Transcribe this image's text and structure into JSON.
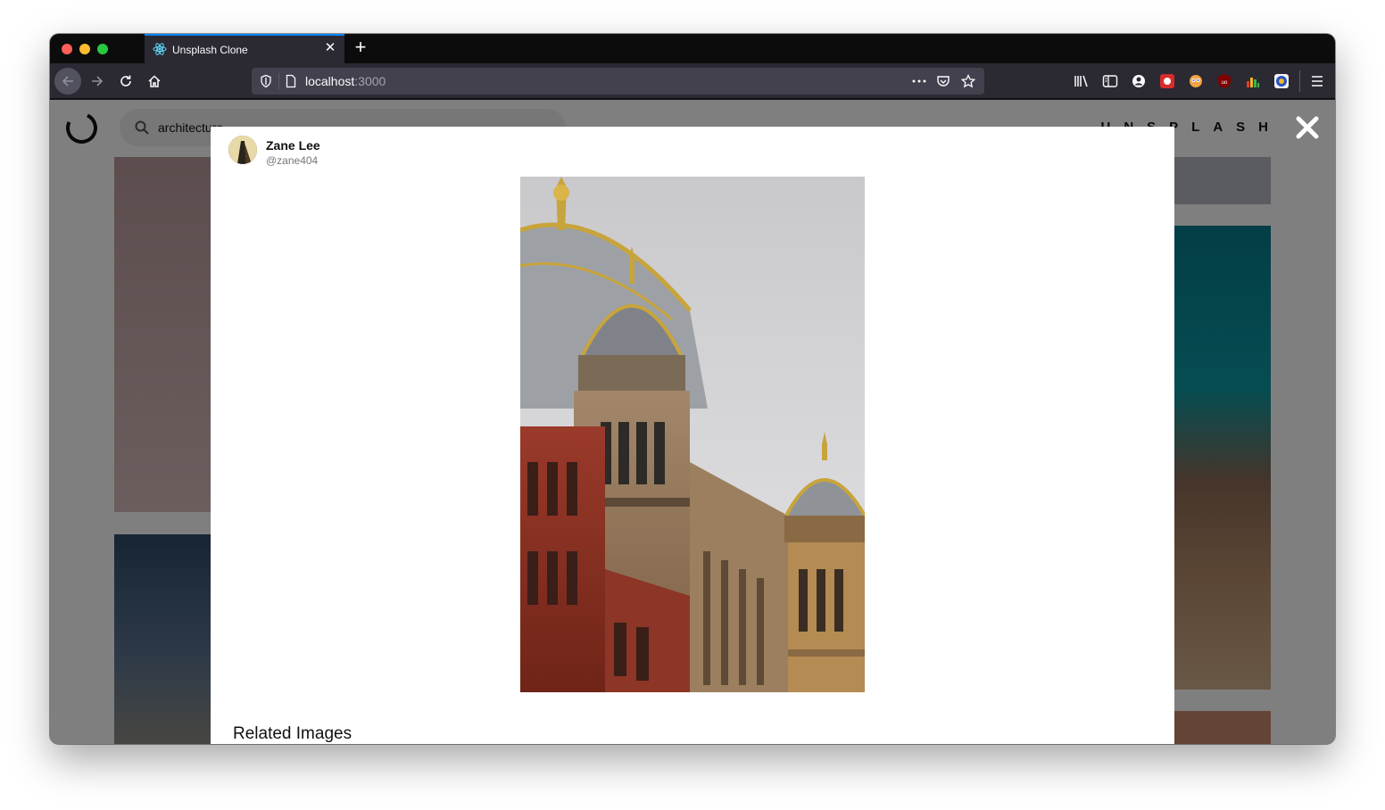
{
  "browser": {
    "tab_title": "Unsplash Clone",
    "url_host": "localhost",
    "url_port": ":3000"
  },
  "app": {
    "search_query": "architecture",
    "brand": "UNSPLASH"
  },
  "modal": {
    "user_name": "Zane Lee",
    "user_handle": "@zane404",
    "related_heading": "Related Images"
  },
  "icons": [
    "react-icon",
    "close-icon",
    "plus-icon",
    "back-icon",
    "forward-icon",
    "reload-icon",
    "home-icon",
    "shield-icon",
    "page-icon",
    "more-icon",
    "pocket-icon",
    "star-icon",
    "library-icon",
    "sidebar-icon",
    "account-icon",
    "extension-icon",
    "menu-icon",
    "search-icon"
  ],
  "colors": {
    "accent": "#0a84ff",
    "toolbar": "#2b2a33",
    "tabstrip": "#0c0c0d"
  }
}
